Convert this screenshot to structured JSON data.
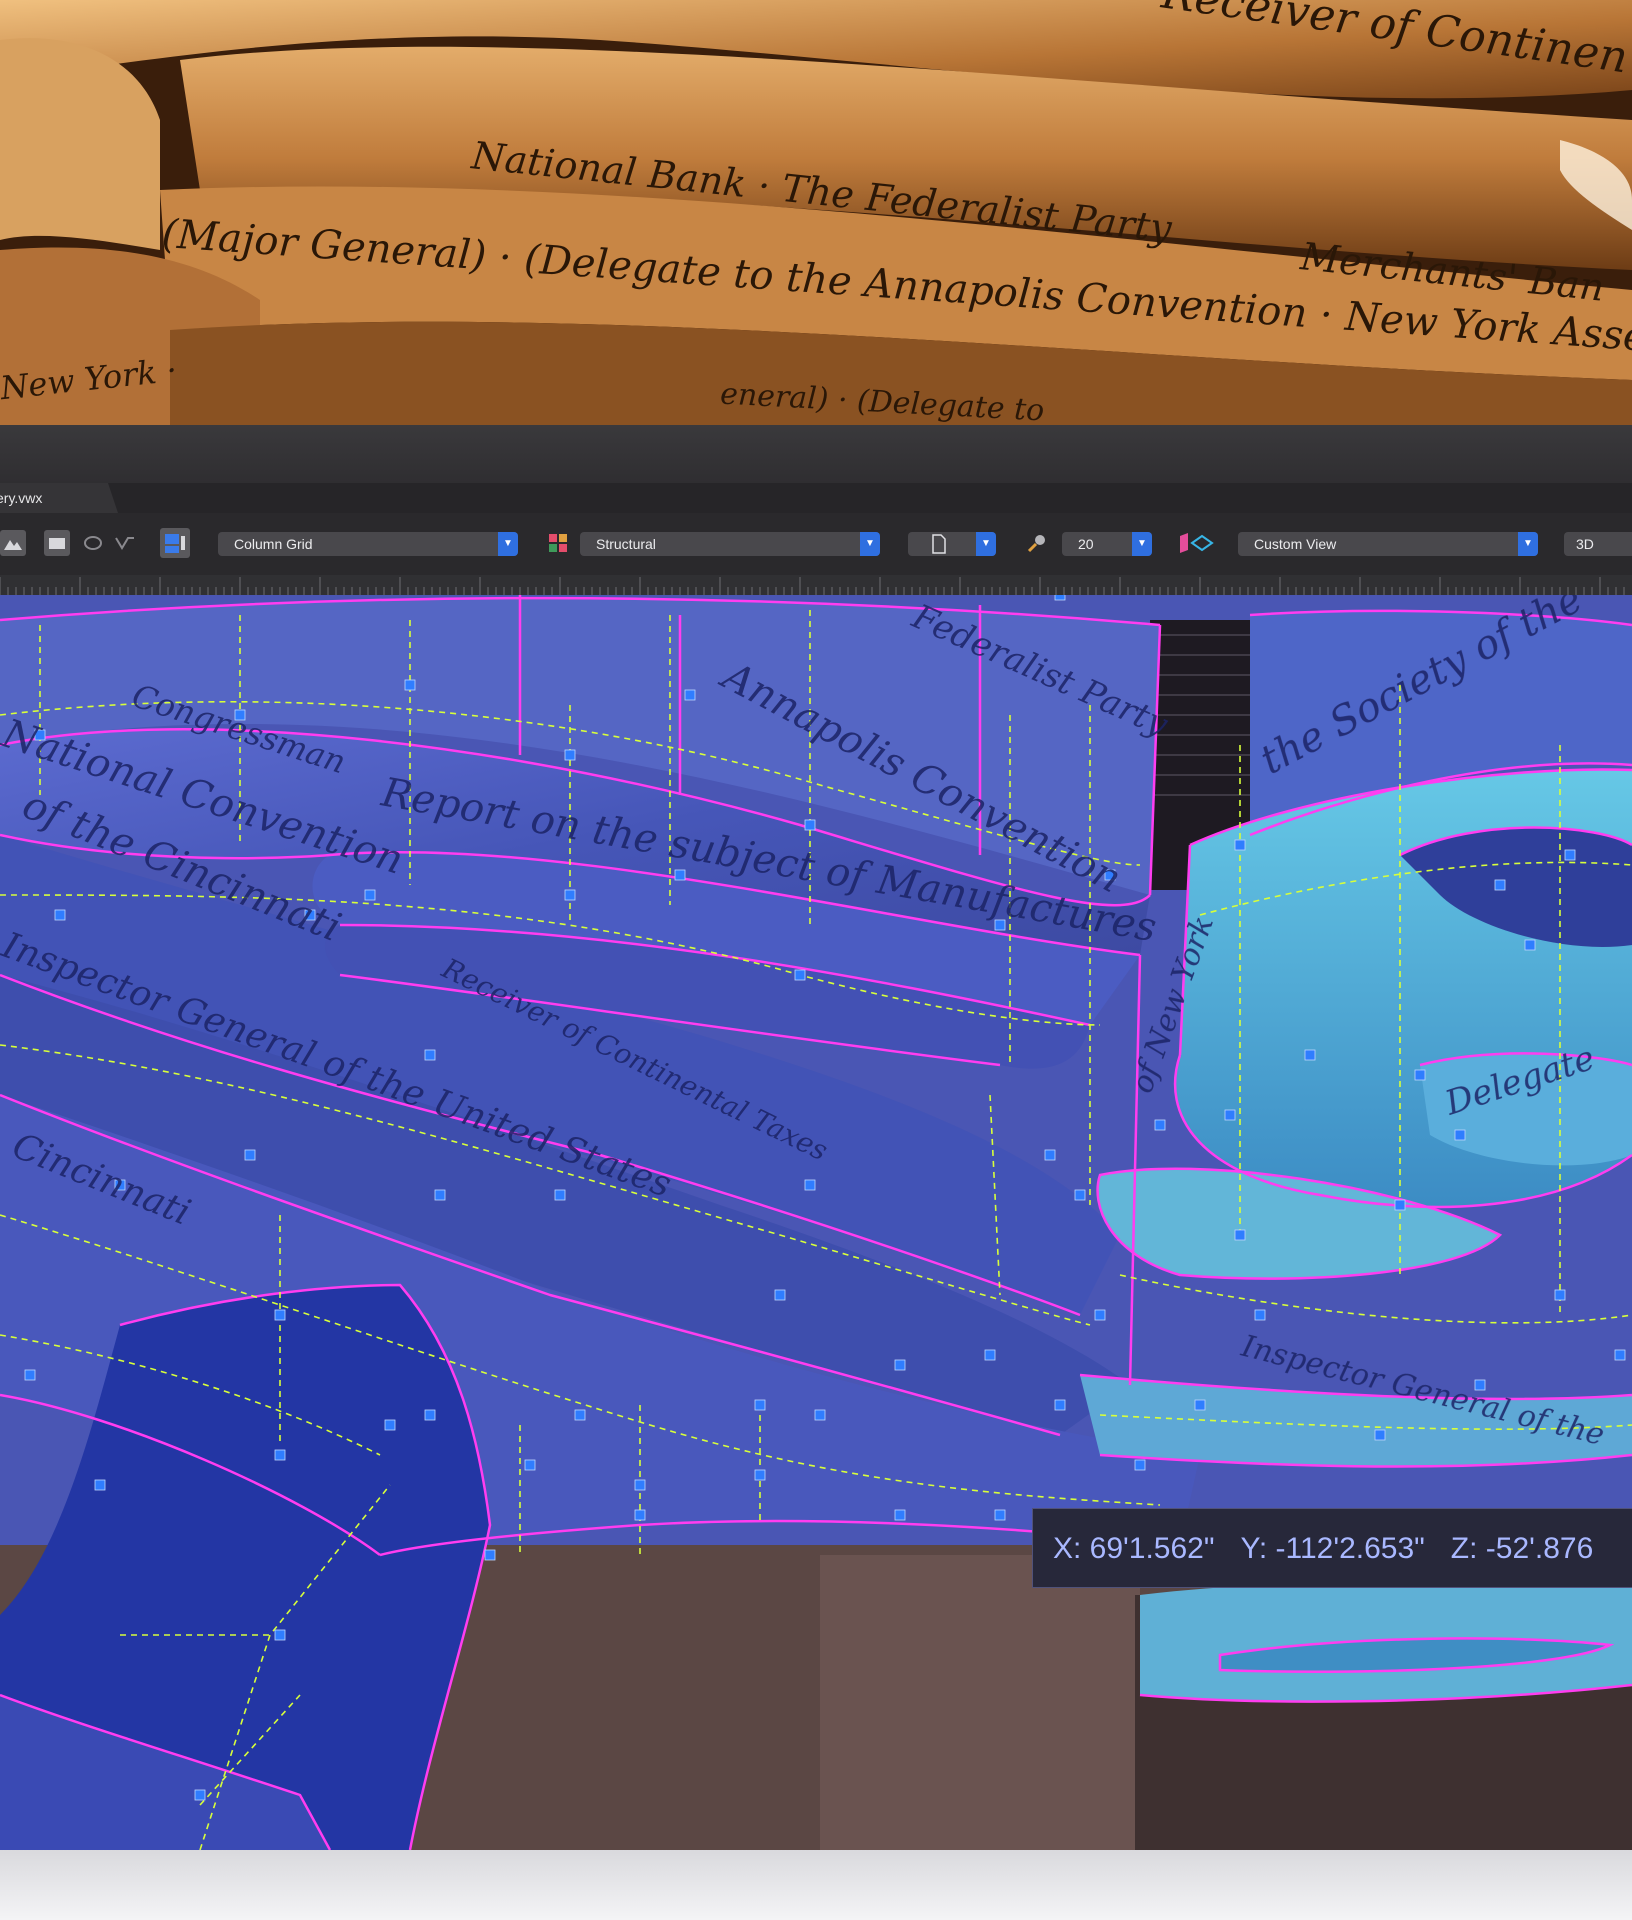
{
  "photo_script": {
    "line1": "Receiver of Continen",
    "line2": "National Bank · The Federalist Party",
    "line3": "(Major General) · (Delegate to the Annapolis Convention · New York Assemb",
    "line4": "Merchants' Ban",
    "line5": "New York ·",
    "line6": "eneral) · (Delegate to"
  },
  "window": {
    "tab_label": "ery.vwx"
  },
  "toolbar": {
    "class_select": "Column Grid",
    "layer_select": "Structural",
    "scale_value": "20",
    "view_select": "Custom View",
    "render_button": "3D",
    "icons": [
      "image-icon",
      "rectangle-tool-icon",
      "ellipse-tool-icon",
      "bezier-tool-icon",
      "layer-options-icon",
      "class-color-icon",
      "page-icon",
      "zoom-icon",
      "view-cube-icon"
    ]
  },
  "canvas_script": {
    "a": "Annapolis Convention",
    "b": "Federalist Party",
    "c": "the Society of the",
    "d": "Report on the subject of Manufactures",
    "e": "Congressman",
    "f": "National Convention",
    "g": "of the Cincinnati",
    "h": "Inspector General of the United States",
    "i": "Receiver of Continental Taxes",
    "j": "Cincinnati",
    "k": "Inspector General of the",
    "l": "Delegate",
    "m": "of New York"
  },
  "coordinates": {
    "x": "X: 69'1.562\"",
    "y": "Y: -112'2.653\"",
    "z": "Z: -52'.876"
  },
  "colors": {
    "edge": "#ff3df0",
    "guide": "#d8ff3a",
    "handle": "#2f7dff",
    "accent": "#2f6fe0"
  }
}
